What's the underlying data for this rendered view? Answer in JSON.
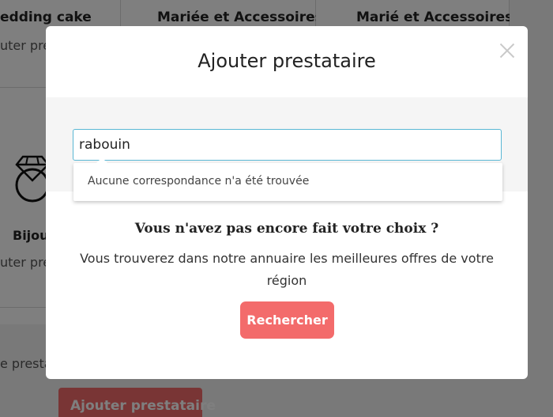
{
  "background": {
    "header_cells": [
      "edding cake",
      "Mariée et Accessoires",
      "Marié et Accessoires"
    ],
    "header_sub": "uter pre",
    "left_category_label": "Bijou",
    "left_category_sub": "uter pre",
    "left_bottom_sub": "e presta",
    "bottom_button_label": "Ajouter prestataire"
  },
  "modal": {
    "title": "Ajouter prestataire",
    "search": {
      "value": "rabouin",
      "no_match_text": "Aucune correspondance n'a été trouvée"
    },
    "choice_title": "Vous n'avez pas encore fait votre choix ?",
    "choice_desc": "Vous trouverez dans notre annuaire les meilleures offres de votre région",
    "search_button_label": "Rechercher"
  },
  "colors": {
    "accent": "#f36b6b",
    "input_border": "#5ab7d4",
    "overlay": "rgba(0,0,0,0.5)"
  },
  "icons": {
    "ring": "ring-icon",
    "close": "close-icon"
  }
}
